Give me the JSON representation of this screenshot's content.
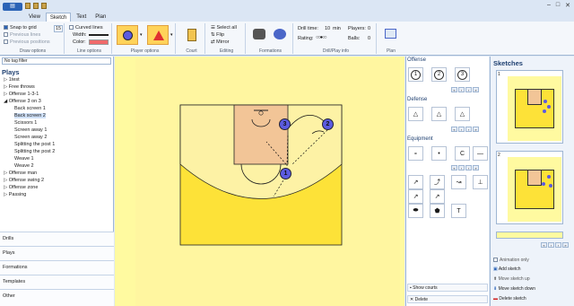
{
  "window": {
    "min": "–",
    "max": "□",
    "close": "✕"
  },
  "tabs": [
    "View",
    "Sketch",
    "Text",
    "Plan"
  ],
  "ribbon": {
    "draw": {
      "snap": "Snap to grid",
      "grid_value": "15",
      "prev_lines": "Previous lines",
      "prev_pos": "Previous positions",
      "label": "Draw options"
    },
    "line": {
      "curved": "Curved lines",
      "width": "Width:",
      "color": "Color:",
      "label": "Line options"
    },
    "player": {
      "label": "Player options"
    },
    "court": {
      "label": "Court"
    },
    "editing": {
      "select_all": "Select all",
      "flip": "Flip",
      "mirror": "Mirror",
      "label": "Editing"
    },
    "formations": {
      "label": "Formations"
    },
    "drill": {
      "time_label": "Drill time:",
      "time": "10",
      "unit": "min",
      "players_label": "Players:",
      "players": "0",
      "rating": "Rating:",
      "balls_label": "Balls:",
      "balls": "0",
      "label": "Drill/Play info"
    },
    "plan": {
      "label": "Plan"
    }
  },
  "left": {
    "filter": "No tag filter",
    "title": "Plays",
    "tree": [
      "1test",
      "Free throws",
      "Offense 1-3-1",
      "Offense 3 on 3",
      "Back screen 1",
      "Back screen 2",
      "Scissors 1",
      "Screen away 1",
      "Screen away 2",
      "Splitting the post 1",
      "Splitting the post 2",
      "Weave 1",
      "Weave 2",
      "Offense man",
      "Offense swing 2",
      "Offense zone",
      "Passing"
    ],
    "nav": [
      "Drills",
      "Plays",
      "Formations",
      "Templates",
      "Other"
    ]
  },
  "players": {
    "p1": "1",
    "p2": "2",
    "p3": "3"
  },
  "right": {
    "offense": "Offense",
    "offense_items": [
      "1",
      "2",
      "3"
    ],
    "defense": "Defense",
    "equipment": "Equipment",
    "eq_items": [
      "∘",
      "•",
      "C",
      "—"
    ],
    "show_courts": "Show courts",
    "delete": "Delete"
  },
  "sketches": {
    "title": "Sketches",
    "n1": "1",
    "n2": "2",
    "animation": "Animation only",
    "add": "Add sketch",
    "up": "Move sketch up",
    "down": "Move sketch down",
    "delete": "Delete sketch"
  }
}
